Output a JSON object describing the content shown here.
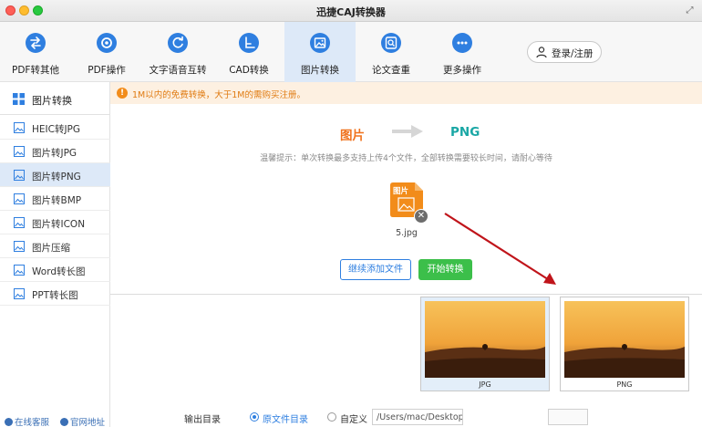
{
  "window": {
    "title": "迅捷CAJ转换器"
  },
  "toolbar": {
    "items": [
      {
        "label": "PDF转其他",
        "icon": "swap-icon"
      },
      {
        "label": "PDF操作",
        "icon": "gear-icon"
      },
      {
        "label": "文字语音互转",
        "icon": "refresh-icon"
      },
      {
        "label": "CAD转换",
        "icon": "cad-icon"
      },
      {
        "label": "图片转换",
        "icon": "image-icon",
        "active": true
      },
      {
        "label": "论文查重",
        "icon": "search-doc-icon"
      },
      {
        "label": "更多操作",
        "icon": "more-icon"
      }
    ],
    "login_label": "登录/注册"
  },
  "sidebar": {
    "header": "图片转换",
    "items": [
      {
        "label": "HEIC转JPG"
      },
      {
        "label": "图片转JPG"
      },
      {
        "label": "图片转PNG",
        "active": true
      },
      {
        "label": "图片转BMP"
      },
      {
        "label": "图片转ICON"
      },
      {
        "label": "图片压缩"
      },
      {
        "label": "Word转长图"
      },
      {
        "label": "PPT转长图"
      }
    ],
    "footer": {
      "service": "在线客服",
      "website": "官网地址"
    }
  },
  "notice": {
    "text": "1M以内的免费转换，大于1M的需购买注册。"
  },
  "conversion": {
    "from": "图片",
    "to": "PNG"
  },
  "hint": "温馨提示：单次转换最多支持上传4个文件，全部转换需要较长时间，请耐心等待",
  "file": {
    "badge": "图片",
    "name": "5.jpg"
  },
  "buttons": {
    "add_files": "继续添加文件",
    "start": "开始转换"
  },
  "thumbnails": [
    {
      "label": "JPG"
    },
    {
      "label": "PNG"
    }
  ],
  "output": {
    "label": "输出目录",
    "option_source": "原文件目录",
    "option_custom": "自定义",
    "path": "/Users/mac/Desktop/"
  },
  "colors": {
    "accent": "#2f7fe0",
    "active_bg": "#dde9f8",
    "from_color": "#f0731e",
    "to_color": "#1aa7a5",
    "start_button": "#3cbf4a",
    "notice_text": "#e07b12",
    "annotation_arrow": "#c0141a"
  }
}
